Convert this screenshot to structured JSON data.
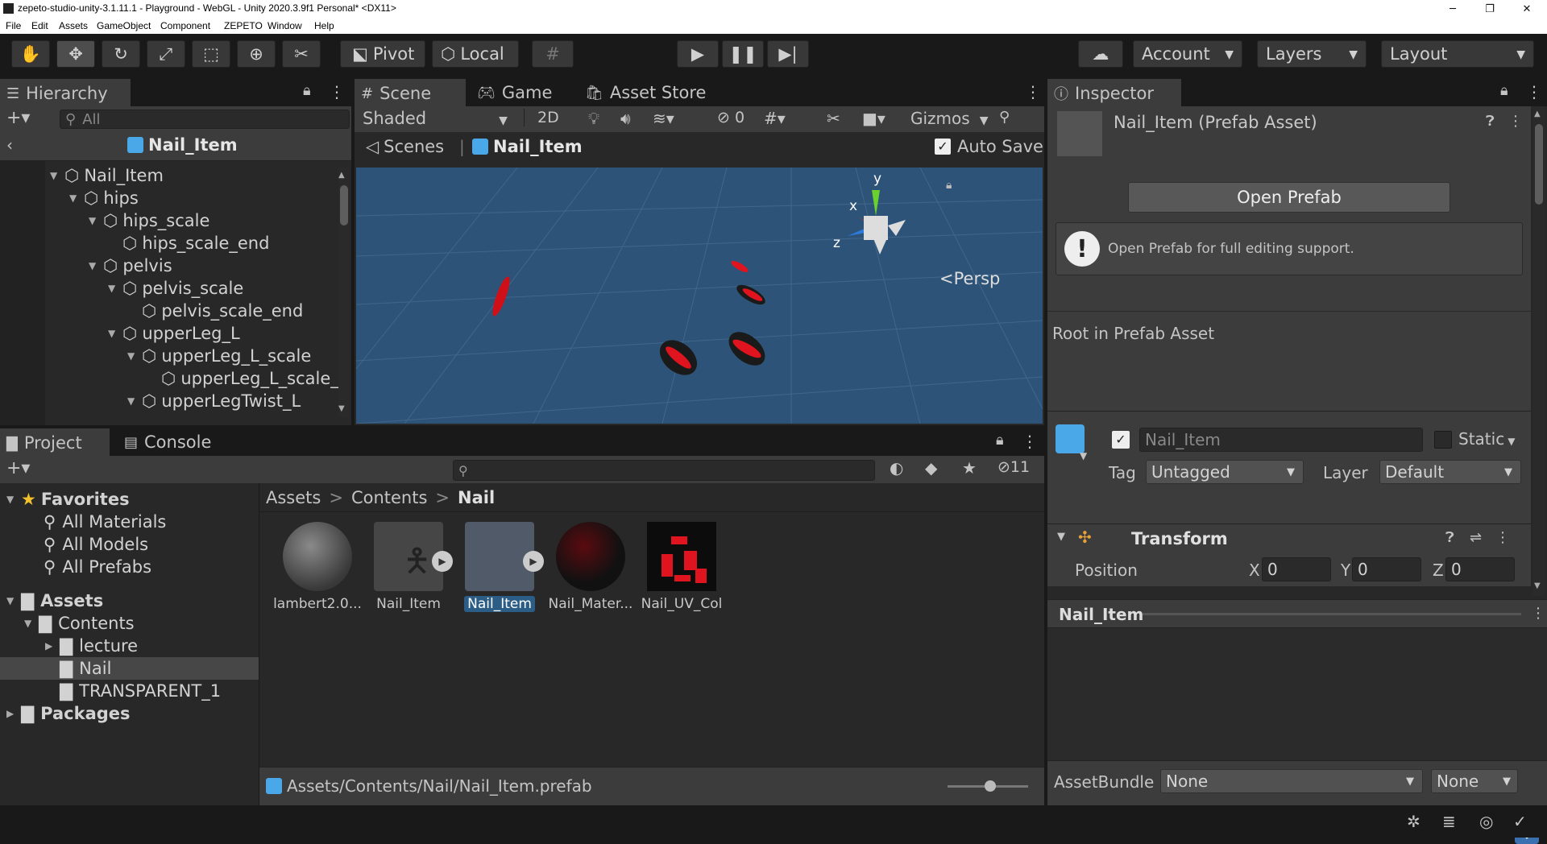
{
  "window": {
    "title": "zepeto-studio-unity-3.1.11.1 - Playground - WebGL - Unity 2020.3.9f1 Personal* <DX11>",
    "minimize": "─",
    "maximize": "❐",
    "close": "✕"
  },
  "menu": [
    "File",
    "Edit",
    "Assets",
    "GameObject",
    "Component",
    "ZEPETO",
    "Window",
    "Help"
  ],
  "toolbar": {
    "pivot": "Pivot",
    "local": "Local",
    "account": "Account",
    "layers": "Layers",
    "layout": "Layout"
  },
  "hierarchy": {
    "tab": "Hierarchy",
    "search_placeholder": "All",
    "root": "Nail_Item",
    "items": [
      {
        "label": "Nail_Item",
        "depth": 0,
        "expanded": true
      },
      {
        "label": "hips",
        "depth": 1,
        "expanded": true
      },
      {
        "label": "hips_scale",
        "depth": 2,
        "expanded": true
      },
      {
        "label": "hips_scale_end",
        "depth": 3,
        "expanded": false
      },
      {
        "label": "pelvis",
        "depth": 2,
        "expanded": true
      },
      {
        "label": "pelvis_scale",
        "depth": 3,
        "expanded": true
      },
      {
        "label": "pelvis_scale_end",
        "depth": 4,
        "expanded": false
      },
      {
        "label": "upperLeg_L",
        "depth": 3,
        "expanded": true
      },
      {
        "label": "upperLeg_L_scale",
        "depth": 4,
        "expanded": true
      },
      {
        "label": "upperLeg_L_scale_",
        "depth": 5,
        "expanded": false
      },
      {
        "label": "upperLegTwist_L",
        "depth": 4,
        "expanded": true
      }
    ]
  },
  "scene": {
    "tabs": [
      "Scene",
      "Game",
      "Asset Store"
    ],
    "shading": "Shaded",
    "mode_2d": "2D",
    "hidden_count": "0",
    "gizmos": "Gizmos",
    "breadcrumb_root": "Scenes",
    "breadcrumb_item": "Nail_Item",
    "auto_save": "Auto Save",
    "persp": "Persp",
    "axis_x": "x",
    "axis_y": "y",
    "axis_z": "z"
  },
  "project": {
    "tabs": [
      "Project",
      "Console"
    ],
    "hidden_count": "11",
    "favorites": "Favorites",
    "favorite_items": [
      "All Materials",
      "All Models",
      "All Prefabs"
    ],
    "assets_root": "Assets",
    "contents": "Contents",
    "folders": [
      "lecture",
      "Nail",
      "TRANSPARENT_1"
    ],
    "packages": "Packages",
    "breadcrumb": [
      "Assets",
      "Contents",
      "Nail"
    ],
    "assets": [
      "lambert2.0...",
      "Nail_Item",
      "Nail_Item",
      "Nail_Mater...",
      "Nail_UV_Col"
    ],
    "selected_path": "Assets/Contents/Nail/Nail_Item.prefab"
  },
  "inspector": {
    "tab": "Inspector",
    "title": "Nail_Item (Prefab Asset)",
    "open_prefab": "Open Prefab",
    "info": "Open Prefab for full editing support.",
    "root_label": "Root in Prefab Asset",
    "object_name": "Nail_Item",
    "static": "Static",
    "tag_label": "Tag",
    "tag_value": "Untagged",
    "layer_label": "Layer",
    "layer_value": "Default",
    "transform": "Transform",
    "position": "Position",
    "x_label": "X",
    "x_value": "0",
    "y_label": "Y",
    "y_value": "0",
    "z_label": "Z",
    "z_value": "0",
    "preview_name": "Nail_Item",
    "assetbundle_label": "AssetBundle",
    "assetbundle_value": "None",
    "variant_value": "None"
  },
  "colors": {
    "accent": "#2c5d87",
    "scene_bg": "#2d5478",
    "nail_red": "#e0141e"
  }
}
